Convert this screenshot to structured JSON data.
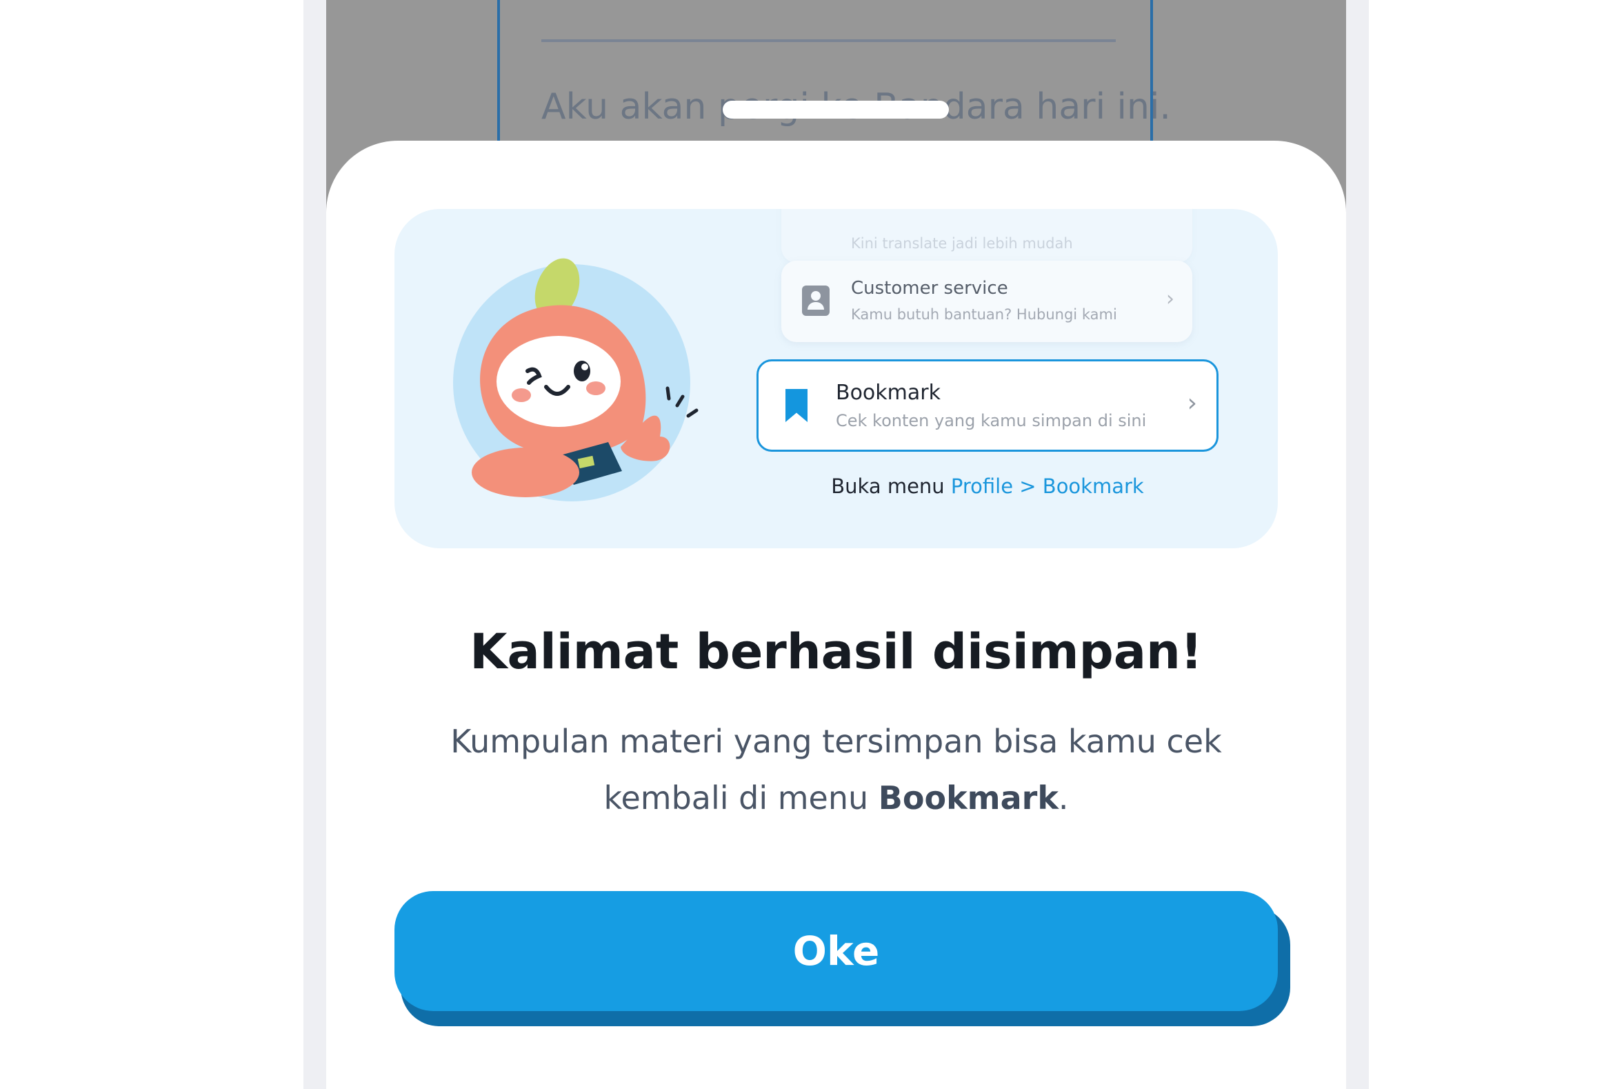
{
  "background": {
    "sentence": "Aku akan pergi ke Bandara hari ini."
  },
  "panel": {
    "faded_item": {
      "subtitle": "Kini translate jadi lebih mudah"
    },
    "customer_service": {
      "title": "Customer service",
      "subtitle": "Kamu butuh bantuan? Hubungi kami",
      "icon": "contact-icon"
    },
    "bookmark": {
      "title": "Bookmark",
      "subtitle": "Cek konten yang kamu simpan di sini",
      "icon": "bookmark-icon"
    },
    "hint_prefix": "Buka menu",
    "hint_link": "Profile > Bookmark"
  },
  "dialog": {
    "title": "Kalimat berhasil disimpan!",
    "desc_part1": "Kumpulan materi yang tersimpan bisa kamu cek kembali di menu",
    "desc_bold": "Bookmark",
    "desc_end": ".",
    "ok_label": "Oke"
  },
  "colors": {
    "primary": "#169de3",
    "primary_shadow": "#0f6ea8",
    "panel_bg": "#e9f5fd",
    "overlay": "#979797",
    "mascot_hood": "#f3907a"
  }
}
